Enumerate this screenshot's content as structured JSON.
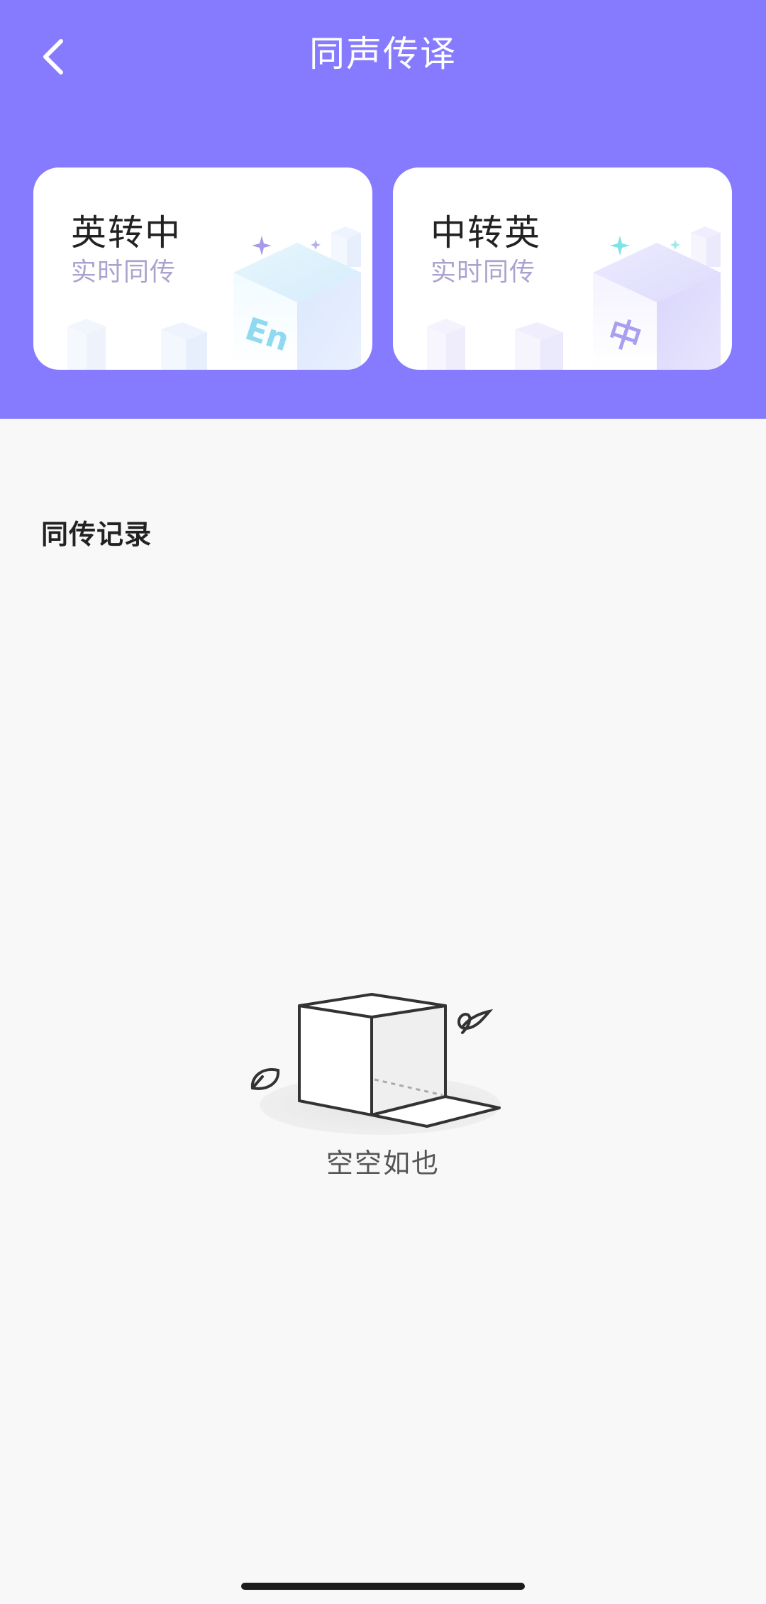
{
  "header": {
    "title": "同声传译",
    "back_icon": "chevron-left-icon",
    "background_color": "#867bff"
  },
  "cards": [
    {
      "title": "英转中",
      "subtitle": "实时同传",
      "cube_label": "En",
      "accent_color": "#8ee0f2"
    },
    {
      "title": "中转英",
      "subtitle": "实时同传",
      "cube_label": "中",
      "accent_color": "#a79df0"
    }
  ],
  "records": {
    "section_title": "同传记录",
    "empty_text": "空空如也",
    "empty_icon": "empty-box-icon"
  }
}
